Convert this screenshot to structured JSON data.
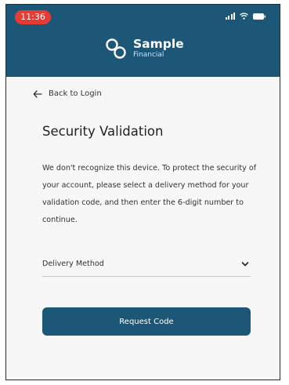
{
  "status_bar": {
    "time": "11:36"
  },
  "brand": {
    "name": "Sample",
    "subtitle": "Financial"
  },
  "back_link": {
    "label": "Back to Login"
  },
  "page": {
    "title": "Security Validation",
    "description": "We don't recognize this device. To protect the security of your account, please select a delivery method for your validation code, and then enter the 6-digit number to continue."
  },
  "delivery_method": {
    "label": "Delivery Method"
  },
  "request_button": {
    "label": "Request Code"
  },
  "colors": {
    "brand_primary": "#1d5778",
    "status_pill": "#e63b33"
  },
  "icons": [
    "signal-icon",
    "wifi-icon",
    "battery-icon",
    "brand-logo-icon",
    "back-arrow-icon",
    "chevron-down-icon"
  ]
}
